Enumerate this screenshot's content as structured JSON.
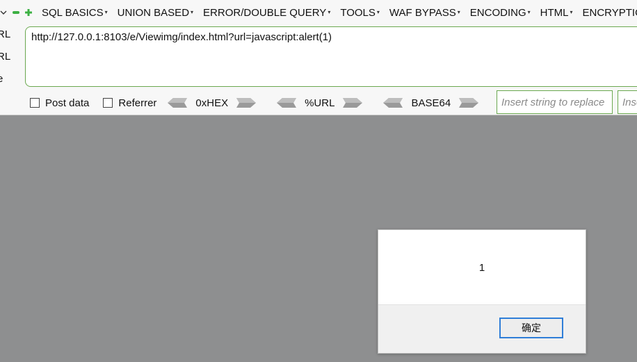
{
  "menubar": {
    "items": [
      "SQL BASICS",
      "UNION BASED",
      "ERROR/DOUBLE QUERY",
      "TOOLS",
      "WAF BYPASS",
      "ENCODING",
      "HTML",
      "ENCRYPTIO"
    ]
  },
  "left_labels": [
    "RL",
    "RL",
    "e"
  ],
  "url": {
    "value": "http://127.0.0.1:8103/e/Viewimg/index.html?url=javascript:alert(1)"
  },
  "options": {
    "post_data": "Post data",
    "referrer": "Referrer",
    "hex": "0xHEX",
    "url": "%URL",
    "base64": "BASE64"
  },
  "replace": {
    "placeholder1": "Insert string to replace",
    "placeholder2": "Insert"
  },
  "dialog": {
    "message": "1",
    "ok_label": "确定"
  },
  "colors": {
    "accent_green": "#6aa84f",
    "button_focus": "#2f7ed8",
    "backdrop": "#8e8f90"
  }
}
